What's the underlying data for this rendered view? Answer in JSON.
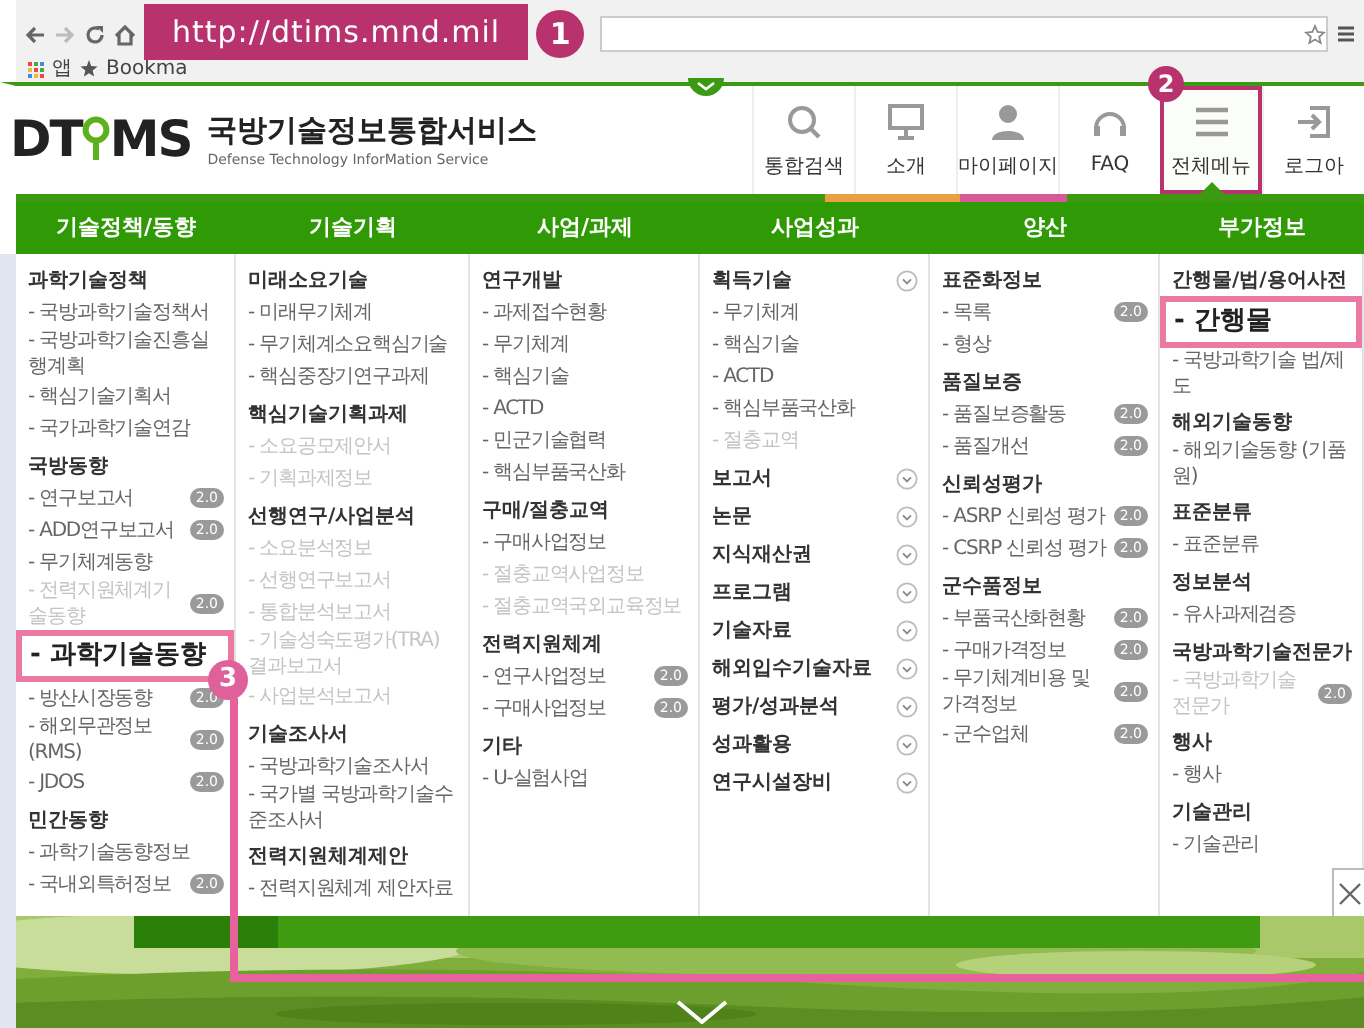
{
  "browser": {
    "url_callout": "http://dtims.mnd.mil",
    "callout_number": "1",
    "bookmarks": [
      {
        "kind": "apps",
        "label": "앱"
      },
      {
        "kind": "star",
        "label": "Bookma"
      }
    ]
  },
  "site": {
    "logo_left": "DT",
    "logo_right": "MS",
    "title": "국방기술정보통합서비스",
    "subtitle": "Defense Technology InforMation Service"
  },
  "nav": [
    {
      "kind": "search",
      "label": "통합검색",
      "selected": false
    },
    {
      "kind": "monitor",
      "label": "소개",
      "selected": false
    },
    {
      "kind": "person",
      "label": "마이페이지",
      "selected": false
    },
    {
      "kind": "headset",
      "label": "FAQ",
      "selected": false
    },
    {
      "kind": "menu",
      "label": "전체메뉴",
      "selected": true,
      "callout": "2"
    },
    {
      "kind": "logout",
      "label": "로그아",
      "selected": false
    }
  ],
  "menu": {
    "columns": [
      {
        "title": "기술정책/동향",
        "items": [
          {
            "kind": "heading",
            "text": "과학기술정책",
            "toggle": false
          },
          {
            "kind": "link",
            "text": "- 국방과학기술정책서",
            "disabled": false
          },
          {
            "kind": "link",
            "text": "- 국방과학기술진흥실행계획",
            "disabled": false
          },
          {
            "kind": "link",
            "text": "- 핵심기술기획서",
            "disabled": false
          },
          {
            "kind": "link",
            "text": "- 국가과학기술연감",
            "disabled": false
          },
          {
            "kind": "heading",
            "text": "국방동향",
            "toggle": false
          },
          {
            "kind": "link",
            "text": "- 연구보고서",
            "disabled": false,
            "badge": "2.0"
          },
          {
            "kind": "link",
            "text": "- ADD연구보고서",
            "disabled": false,
            "badge": "2.0"
          },
          {
            "kind": "link",
            "text": "- 무기체계동향",
            "disabled": false
          },
          {
            "kind": "link",
            "text": "- 전력지원체계기술동향",
            "disabled": true,
            "badge": "2.0"
          },
          {
            "kind": "callout",
            "text": "- 과학기술동향",
            "number": "3"
          },
          {
            "kind": "link",
            "text": "- 방산시장동향",
            "disabled": false,
            "badge": "2.0"
          },
          {
            "kind": "link",
            "text": "- 해외무관정보(RMS)",
            "disabled": false,
            "badge": "2.0"
          },
          {
            "kind": "link",
            "text": "- JDOS",
            "disabled": false,
            "badge": "2.0"
          },
          {
            "kind": "heading",
            "text": "민간동향",
            "toggle": false
          },
          {
            "kind": "link",
            "text": "- 과학기술동향정보",
            "disabled": false
          },
          {
            "kind": "link",
            "text": "- 국내외특허정보",
            "disabled": false,
            "badge": "2.0"
          }
        ]
      },
      {
        "title": "기술기획",
        "items": [
          {
            "kind": "heading",
            "text": "미래소요기술",
            "toggle": false
          },
          {
            "kind": "link",
            "text": "- 미래무기체계",
            "disabled": false
          },
          {
            "kind": "link",
            "text": "- 무기체계소요핵심기술",
            "disabled": false
          },
          {
            "kind": "link",
            "text": "- 핵심중장기연구과제",
            "disabled": false
          },
          {
            "kind": "heading",
            "text": "핵심기술기획과제",
            "toggle": false
          },
          {
            "kind": "link",
            "text": "- 소요공모제안서",
            "disabled": true
          },
          {
            "kind": "link",
            "text": "- 기획과제정보",
            "disabled": true
          },
          {
            "kind": "heading",
            "text": "선행연구/사업분석",
            "toggle": false
          },
          {
            "kind": "link",
            "text": "- 소요분석정보",
            "disabled": true
          },
          {
            "kind": "link",
            "text": "- 선행연구보고서",
            "disabled": true
          },
          {
            "kind": "link",
            "text": "- 통합분석보고서",
            "disabled": true
          },
          {
            "kind": "link",
            "text": "- 기술성숙도평가(TRA) 결과보고서",
            "disabled": true
          },
          {
            "kind": "link",
            "text": "- 사업분석보고서",
            "disabled": true
          },
          {
            "kind": "heading",
            "text": "기술조사서",
            "toggle": false
          },
          {
            "kind": "link",
            "text": "- 국방과학기술조사서",
            "disabled": false
          },
          {
            "kind": "link",
            "text": "- 국가별 국방과학기술수준조사서",
            "disabled": false
          },
          {
            "kind": "heading",
            "text": "전력지원체계제안",
            "toggle": false
          },
          {
            "kind": "link",
            "text": "- 전력지원체계 제안자료",
            "disabled": false
          }
        ]
      },
      {
        "title": "사업/과제",
        "items": [
          {
            "kind": "heading",
            "text": "연구개발",
            "toggle": false
          },
          {
            "kind": "link",
            "text": "- 과제접수현황",
            "disabled": false
          },
          {
            "kind": "link",
            "text": "- 무기체계",
            "disabled": false
          },
          {
            "kind": "link",
            "text": "- 핵심기술",
            "disabled": false
          },
          {
            "kind": "link",
            "text": "- ACTD",
            "disabled": false
          },
          {
            "kind": "link",
            "text": "- 민군기술협력",
            "disabled": false
          },
          {
            "kind": "link",
            "text": "- 핵심부품국산화",
            "disabled": false
          },
          {
            "kind": "heading",
            "text": "구매/절충교역",
            "toggle": false
          },
          {
            "kind": "link",
            "text": "- 구매사업정보",
            "disabled": false
          },
          {
            "kind": "link",
            "text": "- 절충교역사업정보",
            "disabled": true
          },
          {
            "kind": "link",
            "text": "- 절충교역국외교육정보",
            "disabled": true
          },
          {
            "kind": "heading",
            "text": "전력지원체계",
            "toggle": false
          },
          {
            "kind": "link",
            "text": "- 연구사업정보",
            "disabled": false,
            "badge": "2.0"
          },
          {
            "kind": "link",
            "text": "- 구매사업정보",
            "disabled": false,
            "badge": "2.0"
          },
          {
            "kind": "heading",
            "text": "기타",
            "toggle": false
          },
          {
            "kind": "link",
            "text": "- U-실험사업",
            "disabled": false
          }
        ]
      },
      {
        "title": "사업성과",
        "items": [
          {
            "kind": "heading",
            "text": "획득기술",
            "toggle": true
          },
          {
            "kind": "link",
            "text": "- 무기체계",
            "disabled": false
          },
          {
            "kind": "link",
            "text": "- 핵심기술",
            "disabled": false
          },
          {
            "kind": "link",
            "text": "- ACTD",
            "disabled": false
          },
          {
            "kind": "link",
            "text": "- 핵심부품국산화",
            "disabled": false
          },
          {
            "kind": "link",
            "text": "- 절충교역",
            "disabled": true
          },
          {
            "kind": "heading",
            "text": "보고서",
            "toggle": true
          },
          {
            "kind": "heading",
            "text": "논문",
            "toggle": true
          },
          {
            "kind": "heading",
            "text": "지식재산권",
            "toggle": true
          },
          {
            "kind": "heading",
            "text": "프로그램",
            "toggle": true
          },
          {
            "kind": "heading",
            "text": "기술자료",
            "toggle": true
          },
          {
            "kind": "heading",
            "text": "해외입수기술자료",
            "toggle": true
          },
          {
            "kind": "heading",
            "text": "평가/성과분석",
            "toggle": true
          },
          {
            "kind": "heading",
            "text": "성과활용",
            "toggle": true
          },
          {
            "kind": "heading",
            "text": "연구시설장비",
            "toggle": true
          }
        ]
      },
      {
        "title": "양산",
        "items": [
          {
            "kind": "heading",
            "text": "표준화정보",
            "toggle": false
          },
          {
            "kind": "link",
            "text": "- 목록",
            "disabled": false,
            "badge": "2.0"
          },
          {
            "kind": "link",
            "text": "- 형상",
            "disabled": false
          },
          {
            "kind": "heading",
            "text": "품질보증",
            "toggle": false
          },
          {
            "kind": "link",
            "text": "- 품질보증활동",
            "disabled": false,
            "badge": "2.0"
          },
          {
            "kind": "link",
            "text": "- 품질개선",
            "disabled": false,
            "badge": "2.0"
          },
          {
            "kind": "heading",
            "text": "신뢰성평가",
            "toggle": false
          },
          {
            "kind": "link",
            "text": "- ASRP 신뢰성 평가",
            "disabled": false,
            "badge": "2.0"
          },
          {
            "kind": "link",
            "text": "- CSRP 신뢰성 평가",
            "disabled": false,
            "badge": "2.0"
          },
          {
            "kind": "heading",
            "text": "군수품정보",
            "toggle": false
          },
          {
            "kind": "link",
            "text": "- 부품국산화현황",
            "disabled": false,
            "badge": "2.0"
          },
          {
            "kind": "link",
            "text": "- 구매가격정보",
            "disabled": false,
            "badge": "2.0"
          },
          {
            "kind": "link",
            "text": "- 무기체계비용 및 가격정보",
            "disabled": false,
            "badge": "2.0"
          },
          {
            "kind": "link",
            "text": "- 군수업체",
            "disabled": false,
            "badge": "2.0"
          }
        ]
      },
      {
        "title": "부가정보",
        "items": [
          {
            "kind": "heading",
            "text": "간행물/법/용어사전",
            "toggle": false
          },
          {
            "kind": "callout",
            "text": "- 간행물"
          },
          {
            "kind": "link",
            "text": "- 국방과학기술 법/제도",
            "disabled": false
          },
          {
            "kind": "heading",
            "text": "해외기술동향",
            "toggle": false
          },
          {
            "kind": "link",
            "text": "- 해외기술동향 (기품원)",
            "disabled": false
          },
          {
            "kind": "heading",
            "text": "표준분류",
            "toggle": false
          },
          {
            "kind": "link",
            "text": "- 표준분류",
            "disabled": false
          },
          {
            "kind": "heading",
            "text": "정보분석",
            "toggle": false
          },
          {
            "kind": "link",
            "text": "- 유사과제검증",
            "disabled": false
          },
          {
            "kind": "heading",
            "text": "국방과학기술전문가",
            "toggle": false
          },
          {
            "kind": "link",
            "text": "- 국방과학기술전문가",
            "disabled": true,
            "badge": "2.0"
          },
          {
            "kind": "heading",
            "text": "행사",
            "toggle": false
          },
          {
            "kind": "link",
            "text": "- 행사",
            "disabled": false
          },
          {
            "kind": "heading",
            "text": "기술관리",
            "toggle": false
          },
          {
            "kind": "link",
            "text": "- 기술관리",
            "disabled": false
          }
        ]
      }
    ]
  }
}
